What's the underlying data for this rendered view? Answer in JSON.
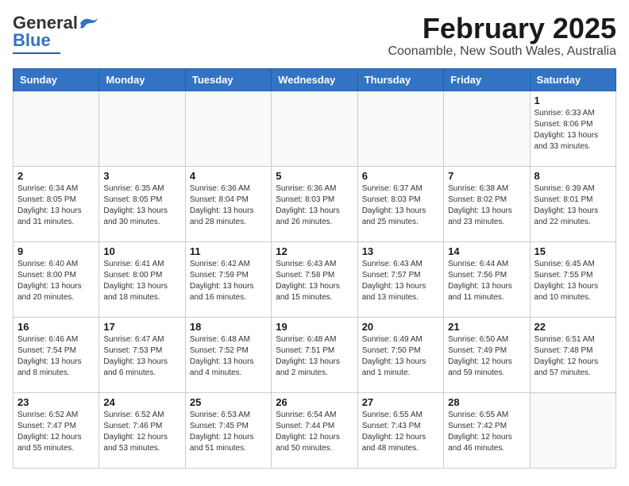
{
  "header": {
    "logo_general": "General",
    "logo_blue": "Blue",
    "title": "February 2025",
    "subtitle": "Coonamble, New South Wales, Australia"
  },
  "columns": [
    "Sunday",
    "Monday",
    "Tuesday",
    "Wednesday",
    "Thursday",
    "Friday",
    "Saturday"
  ],
  "weeks": [
    [
      {
        "day": "",
        "info": ""
      },
      {
        "day": "",
        "info": ""
      },
      {
        "day": "",
        "info": ""
      },
      {
        "day": "",
        "info": ""
      },
      {
        "day": "",
        "info": ""
      },
      {
        "day": "",
        "info": ""
      },
      {
        "day": "1",
        "info": "Sunrise: 6:33 AM\nSunset: 8:06 PM\nDaylight: 13 hours\nand 33 minutes."
      }
    ],
    [
      {
        "day": "2",
        "info": "Sunrise: 6:34 AM\nSunset: 8:05 PM\nDaylight: 13 hours\nand 31 minutes."
      },
      {
        "day": "3",
        "info": "Sunrise: 6:35 AM\nSunset: 8:05 PM\nDaylight: 13 hours\nand 30 minutes."
      },
      {
        "day": "4",
        "info": "Sunrise: 6:36 AM\nSunset: 8:04 PM\nDaylight: 13 hours\nand 28 minutes."
      },
      {
        "day": "5",
        "info": "Sunrise: 6:36 AM\nSunset: 8:03 PM\nDaylight: 13 hours\nand 26 minutes."
      },
      {
        "day": "6",
        "info": "Sunrise: 6:37 AM\nSunset: 8:03 PM\nDaylight: 13 hours\nand 25 minutes."
      },
      {
        "day": "7",
        "info": "Sunrise: 6:38 AM\nSunset: 8:02 PM\nDaylight: 13 hours\nand 23 minutes."
      },
      {
        "day": "8",
        "info": "Sunrise: 6:39 AM\nSunset: 8:01 PM\nDaylight: 13 hours\nand 22 minutes."
      }
    ],
    [
      {
        "day": "9",
        "info": "Sunrise: 6:40 AM\nSunset: 8:00 PM\nDaylight: 13 hours\nand 20 minutes."
      },
      {
        "day": "10",
        "info": "Sunrise: 6:41 AM\nSunset: 8:00 PM\nDaylight: 13 hours\nand 18 minutes."
      },
      {
        "day": "11",
        "info": "Sunrise: 6:42 AM\nSunset: 7:59 PM\nDaylight: 13 hours\nand 16 minutes."
      },
      {
        "day": "12",
        "info": "Sunrise: 6:43 AM\nSunset: 7:58 PM\nDaylight: 13 hours\nand 15 minutes."
      },
      {
        "day": "13",
        "info": "Sunrise: 6:43 AM\nSunset: 7:57 PM\nDaylight: 13 hours\nand 13 minutes."
      },
      {
        "day": "14",
        "info": "Sunrise: 6:44 AM\nSunset: 7:56 PM\nDaylight: 13 hours\nand 11 minutes."
      },
      {
        "day": "15",
        "info": "Sunrise: 6:45 AM\nSunset: 7:55 PM\nDaylight: 13 hours\nand 10 minutes."
      }
    ],
    [
      {
        "day": "16",
        "info": "Sunrise: 6:46 AM\nSunset: 7:54 PM\nDaylight: 13 hours\nand 8 minutes."
      },
      {
        "day": "17",
        "info": "Sunrise: 6:47 AM\nSunset: 7:53 PM\nDaylight: 13 hours\nand 6 minutes."
      },
      {
        "day": "18",
        "info": "Sunrise: 6:48 AM\nSunset: 7:52 PM\nDaylight: 13 hours\nand 4 minutes."
      },
      {
        "day": "19",
        "info": "Sunrise: 6:48 AM\nSunset: 7:51 PM\nDaylight: 13 hours\nand 2 minutes."
      },
      {
        "day": "20",
        "info": "Sunrise: 6:49 AM\nSunset: 7:50 PM\nDaylight: 13 hours\nand 1 minute."
      },
      {
        "day": "21",
        "info": "Sunrise: 6:50 AM\nSunset: 7:49 PM\nDaylight: 12 hours\nand 59 minutes."
      },
      {
        "day": "22",
        "info": "Sunrise: 6:51 AM\nSunset: 7:48 PM\nDaylight: 12 hours\nand 57 minutes."
      }
    ],
    [
      {
        "day": "23",
        "info": "Sunrise: 6:52 AM\nSunset: 7:47 PM\nDaylight: 12 hours\nand 55 minutes."
      },
      {
        "day": "24",
        "info": "Sunrise: 6:52 AM\nSunset: 7:46 PM\nDaylight: 12 hours\nand 53 minutes."
      },
      {
        "day": "25",
        "info": "Sunrise: 6:53 AM\nSunset: 7:45 PM\nDaylight: 12 hours\nand 51 minutes."
      },
      {
        "day": "26",
        "info": "Sunrise: 6:54 AM\nSunset: 7:44 PM\nDaylight: 12 hours\nand 50 minutes."
      },
      {
        "day": "27",
        "info": "Sunrise: 6:55 AM\nSunset: 7:43 PM\nDaylight: 12 hours\nand 48 minutes."
      },
      {
        "day": "28",
        "info": "Sunrise: 6:55 AM\nSunset: 7:42 PM\nDaylight: 12 hours\nand 46 minutes."
      },
      {
        "day": "",
        "info": ""
      }
    ]
  ]
}
